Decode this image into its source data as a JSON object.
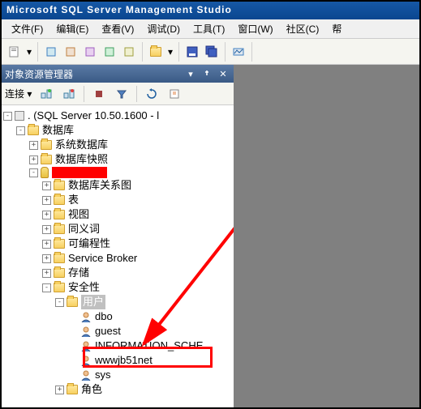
{
  "window": {
    "title": "Microsoft SQL Server Management Studio"
  },
  "menu": {
    "file": "文件(F)",
    "edit": "编辑(E)",
    "view": "查看(V)",
    "debug": "调试(D)",
    "tools": "工具(T)",
    "window": "窗口(W)",
    "community": "社区(C)",
    "help": "帮"
  },
  "panel": {
    "title": "对象资源管理器",
    "connect_label": "连接 ▾"
  },
  "tree": {
    "root": ". (SQL Server 10.50.1600 - l",
    "databases": "数据库",
    "sysdb": "系统数据库",
    "snapshots": "数据库快照",
    "db_diagrams": "数据库关系图",
    "tables": "表",
    "views": "视图",
    "synonyms": "同义词",
    "programmability": "可编程性",
    "service_broker": "Service Broker",
    "storage": "存储",
    "security": "安全性",
    "users": "用户",
    "user_dbo": "dbo",
    "user_guest": "guest",
    "user_infoschema": "INFORMATION_SCHE",
    "user_highlighted": "wwwjb51net",
    "user_sys": "sys",
    "roles": "角色"
  }
}
